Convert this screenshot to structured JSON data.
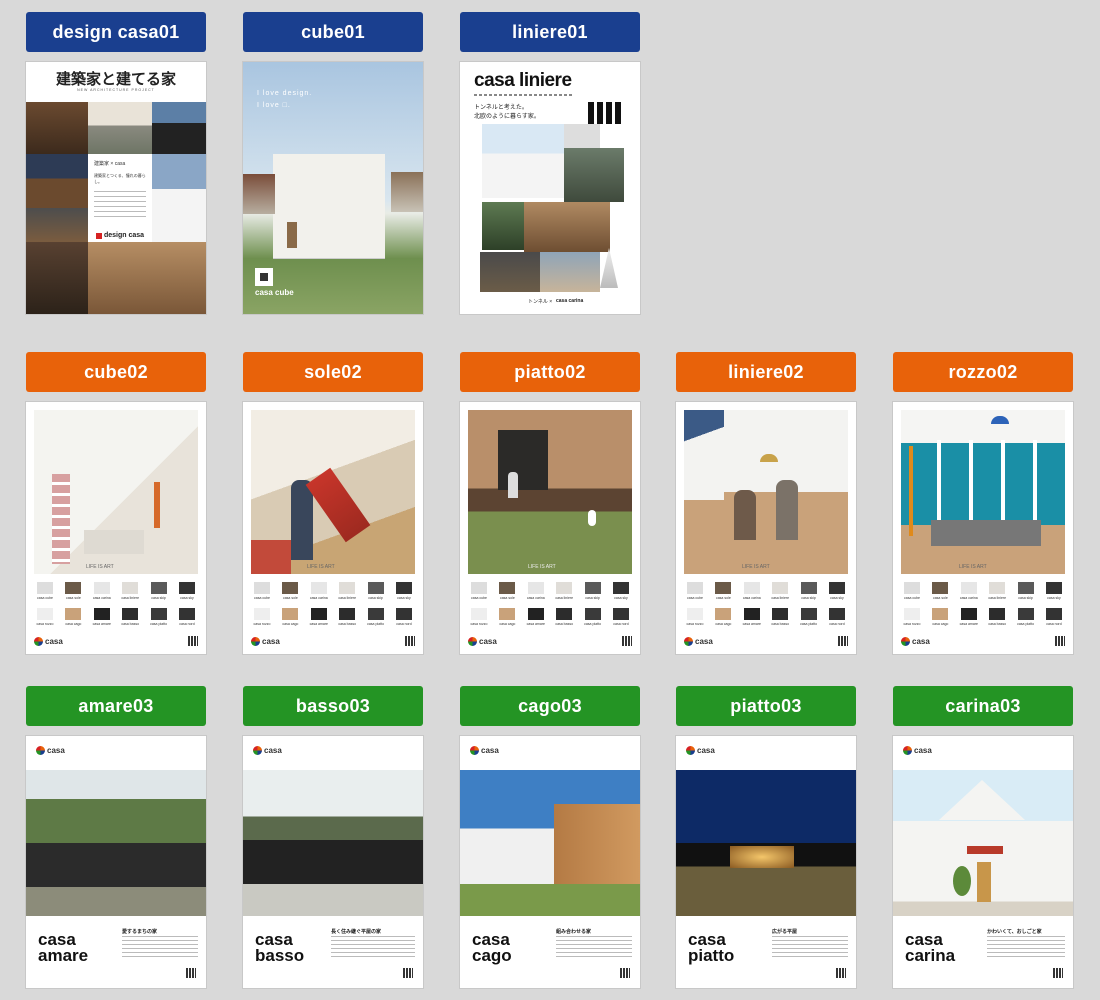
{
  "rows": [
    {
      "color": "blue",
      "items": [
        {
          "id": "design-casa01",
          "label": "design casa01"
        },
        {
          "id": "cube01",
          "label": "cube01"
        },
        {
          "id": "liniere01",
          "label": "liniere01"
        }
      ]
    },
    {
      "color": "orange",
      "items": [
        {
          "id": "cube02",
          "label": "cube02"
        },
        {
          "id": "sole02",
          "label": "sole02"
        },
        {
          "id": "piatto02",
          "label": "piatto02"
        },
        {
          "id": "liniere02",
          "label": "liniere02"
        },
        {
          "id": "rozzo02",
          "label": "rozzo02"
        }
      ]
    },
    {
      "color": "green",
      "items": [
        {
          "id": "amare03",
          "label": "amare03"
        },
        {
          "id": "basso03",
          "label": "basso03"
        },
        {
          "id": "cago03",
          "label": "cago03"
        },
        {
          "id": "piatto03",
          "label": "piatto03"
        },
        {
          "id": "carina03",
          "label": "carina03"
        }
      ]
    }
  ],
  "posters": {
    "design_casa01": {
      "heading": "建築家と建てる家",
      "sub": "NEW ARCHITECTURE PROJECT",
      "brand": "design casa",
      "mid": "建築家 × casa",
      "tag": "建築家とつくる、憧れの暮らし。"
    },
    "cube01": {
      "copy1": "I love design.",
      "copy2": "I love □.",
      "brand": "casa cube"
    },
    "liniere01": {
      "brand": "casa liniere",
      "copy1": "トンネルと考えた。",
      "copy2": "北欧のように暮らす家。",
      "footer_left": "トンネル ×",
      "footer_right": "casa carina"
    },
    "lifeart": "LIFE IS ART",
    "casa_word": "casa",
    "lineup": [
      "casa cube",
      "casa sole",
      "casa carina",
      "casa liniere",
      "casa skip",
      "casa sky",
      "casa rozzo",
      "casa cago",
      "casa amare",
      "casa basso",
      "casa piatto",
      "casa nord"
    ],
    "green": [
      {
        "title1": "casa",
        "title2": "amare",
        "copy": "愛するまちの家"
      },
      {
        "title1": "casa",
        "title2": "basso",
        "copy": "長く住み継ぐ平屋の家"
      },
      {
        "title1": "casa",
        "title2": "cago",
        "copy": "組み合わせる家"
      },
      {
        "title1": "casa",
        "title2": "piatto",
        "copy": "広がる平屋"
      },
      {
        "title1": "casa",
        "title2": "carina",
        "copy": "かわいくて、おしごと家"
      }
    ]
  },
  "colors": {
    "blue": "#1a3f8f",
    "orange": "#e8620a",
    "green": "#249424",
    "background": "#d9d9d9"
  }
}
